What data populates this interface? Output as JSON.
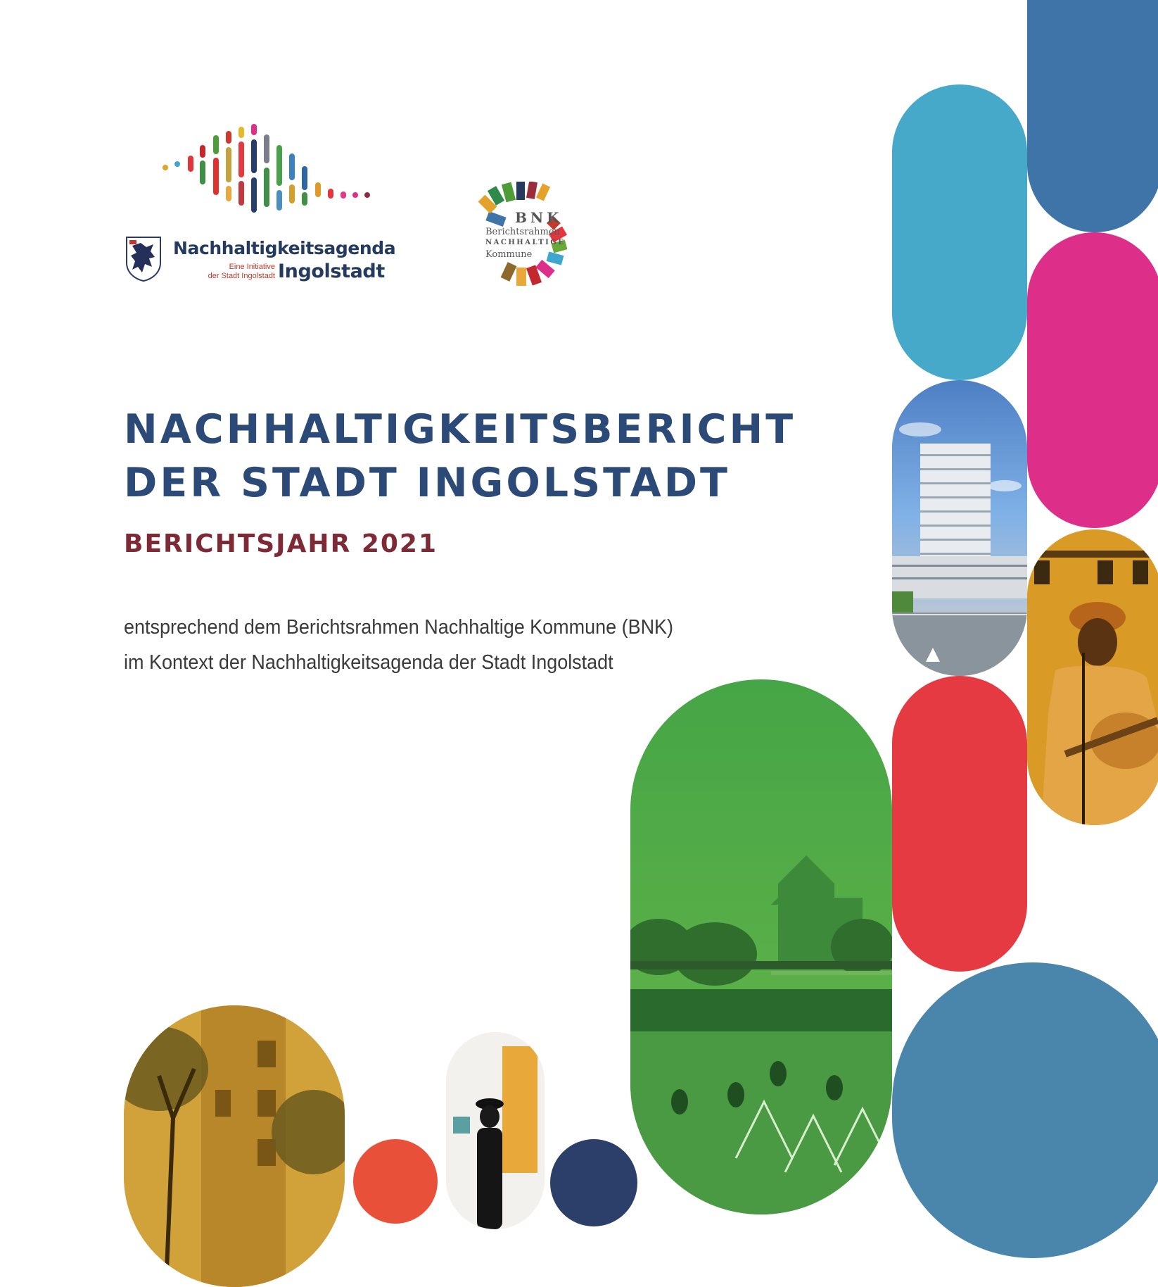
{
  "logos": {
    "agenda": {
      "title": "Nachhaltigkeitsagenda",
      "subline_1": "Eine Initiative",
      "subline_2": "der Stadt Ingolstadt",
      "city": "Ingolstadt"
    },
    "bnk": {
      "abbr": "BNK",
      "line_1": "Berichtsrahmen",
      "line_2": "NACHHALTIGE",
      "line_3": "Kommune"
    }
  },
  "headline": {
    "line_1": "NACHHALTIGKEITSBERICHT",
    "line_2": "DER STADT INGOLSTADT"
  },
  "year_label": "BERICHTSJAHR 2021",
  "description": {
    "line_1": "entsprechend dem Berichtsrahmen Nachhaltige Kommune (BNK)",
    "line_2": "im Kontext der Nachhaltigkeitsagenda der Stadt Ingolstadt"
  },
  "colors": {
    "headline": "#2c4a78",
    "year": "#7d2a36",
    "pill_teal": "#46a9c9",
    "pill_navy": "#3f74a8",
    "pill_magenta": "#dd2f8a",
    "pill_red": "#e63a42",
    "pill_steel": "#4a85ab",
    "pill_green": "#4fa646",
    "pill_ochre": "#dca02a"
  },
  "photos": [
    "high-rise-building-photo",
    "musician-with-guitar-photo",
    "castle-riverside-photo",
    "tree-facade-photo",
    "art-gallery-photo"
  ]
}
